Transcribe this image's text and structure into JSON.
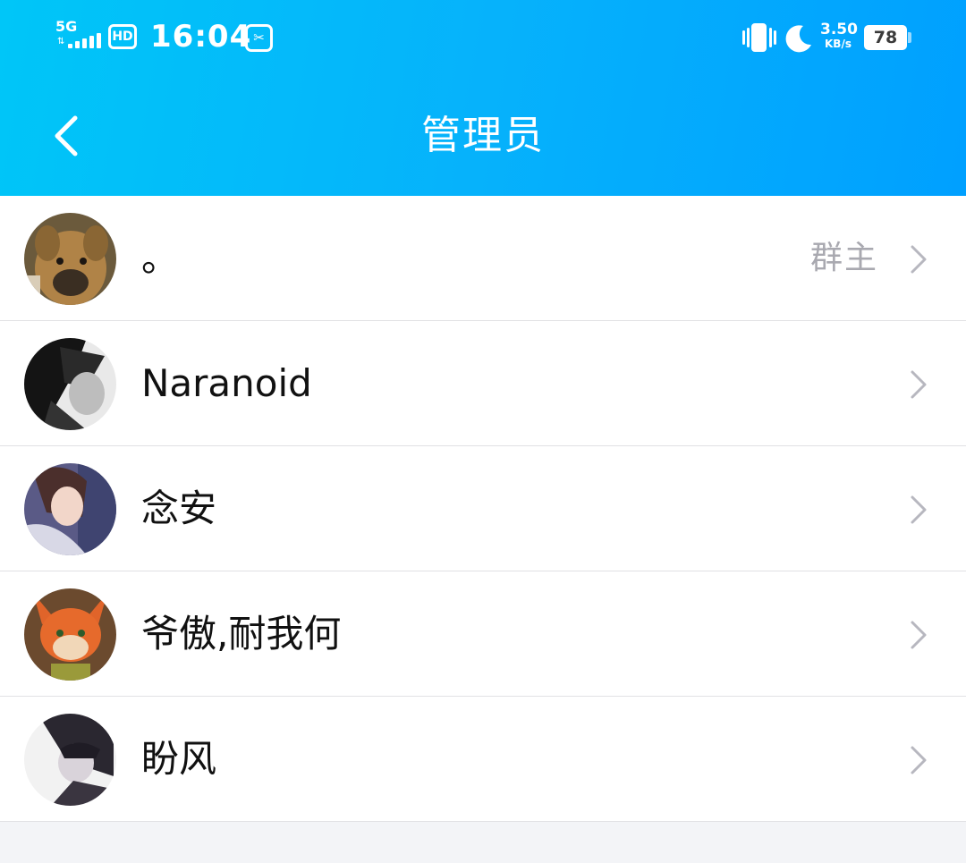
{
  "status_bar": {
    "network": "5G",
    "hd_badge": "HD",
    "time": "16:04",
    "speed_value": "3.50",
    "speed_unit": "KB/s",
    "battery": "78"
  },
  "header": {
    "title": "管理员"
  },
  "admins": [
    {
      "name": "。",
      "role": "群主"
    },
    {
      "name": "Naranoid",
      "role": ""
    },
    {
      "name": "念安",
      "role": ""
    },
    {
      "name": "爷傲,耐我何",
      "role": ""
    },
    {
      "name": "盼风",
      "role": ""
    }
  ],
  "colors": {
    "header_gradient_start": "#00c6f8",
    "header_gradient_end": "#00a0ff",
    "chevron": "#b7b7bf",
    "role_text": "#a9a9b0"
  }
}
